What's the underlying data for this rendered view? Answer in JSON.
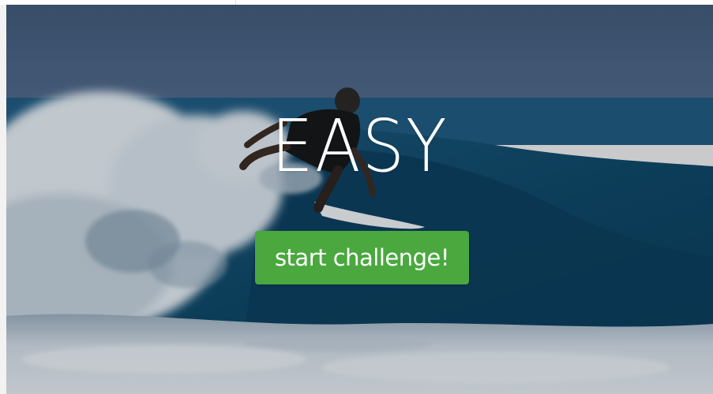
{
  "hero": {
    "headline": "EASY",
    "image_subject": "surfer riding a wave"
  },
  "cta": {
    "label": "start challenge!",
    "color": "#4aa83f"
  },
  "colors": {
    "sky": "#4b6484",
    "ocean": "#0e4a6c",
    "foam": "#dfe6ec",
    "text": "#ffffff"
  }
}
